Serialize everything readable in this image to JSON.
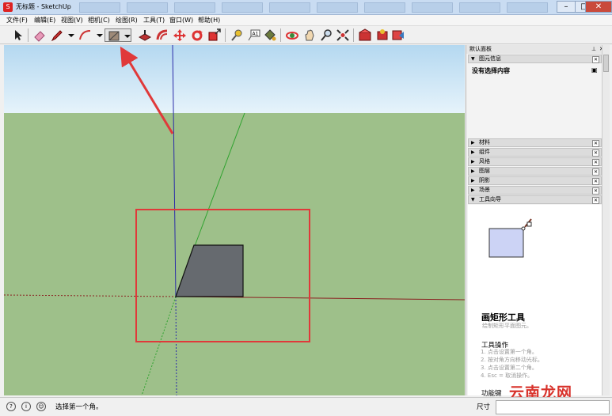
{
  "window": {
    "title": "无标题 - SketchUp",
    "minimize": "–",
    "maximize": "□",
    "close": "✕"
  },
  "menu": [
    "文件(F)",
    "编辑(E)",
    "视图(V)",
    "相机(C)",
    "绘图(R)",
    "工具(T)",
    "窗口(W)",
    "帮助(H)"
  ],
  "toolbar": {
    "selected_tool": "rectangle-tool"
  },
  "tray": {
    "title": "默认面板",
    "entity_info": {
      "label": "图元信息",
      "status": "没有选择内容"
    },
    "panels": [
      "材料",
      "组件",
      "风格",
      "图层",
      "阴影",
      "场景"
    ],
    "instructor": {
      "label": "工具向导",
      "tool_title": "画矩形工具",
      "tool_desc": "绘制矩形平面图元。",
      "operations_title": "工具操作",
      "steps": [
        "1.  点击设置第一个角。",
        "2.  按对角方向移动光标。",
        "3.  点击设置第二个角。",
        "4.  Esc = 取消操作。"
      ],
      "hotkeys_title": "功能键"
    }
  },
  "status": {
    "hint": "选择第一个角。",
    "measure_label": "尺寸",
    "measure_value": ""
  },
  "watermark": "云南龙网",
  "colors": {
    "sky": "#d7ecf8",
    "ground": "#9ec08a",
    "face": "#666a6f",
    "annotation": "#e0393a"
  }
}
